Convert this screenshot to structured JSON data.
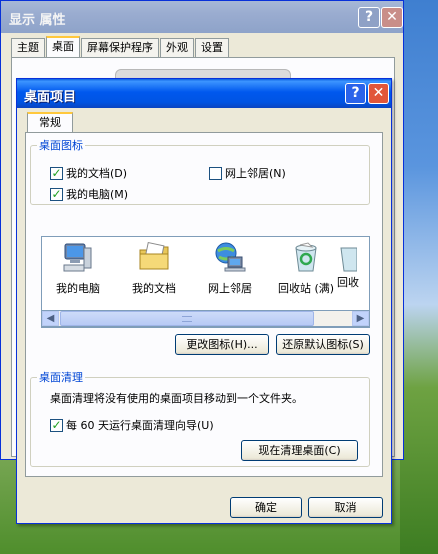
{
  "back_window": {
    "title": "显示 属性",
    "tabs": [
      "主题",
      "桌面",
      "屏幕保护程序",
      "外观",
      "设置"
    ],
    "active_tab_index": 1
  },
  "dialog": {
    "title": "桌面项目",
    "help_symbol": "?",
    "close_symbol": "✕",
    "tab": "常规",
    "desktop_icons": {
      "group_label": "桌面图标",
      "my_documents": {
        "label": "我的文档",
        "hotkey": "(D)",
        "checked": true
      },
      "my_computer": {
        "label": "我的电脑",
        "hotkey": "(M)",
        "checked": true
      },
      "network_places": {
        "label": "网上邻居",
        "hotkey": "(N)",
        "checked": false
      }
    },
    "icon_list": [
      {
        "label": "我的电脑",
        "icon": "my-computer-icon"
      },
      {
        "label": "我的文档",
        "icon": "my-documents-icon"
      },
      {
        "label": "网上邻居",
        "icon": "network-places-icon"
      },
      {
        "label": "回收站 (满)",
        "icon": "recycle-bin-full-icon"
      },
      {
        "label": "回收",
        "icon": "recycle-bin-empty-icon"
      }
    ],
    "change_icon_button": "更改图标(H)...",
    "restore_default_button": "还原默认图标(S)",
    "desktop_cleanup": {
      "group_label": "桌面清理",
      "description": "桌面清理将没有使用的桌面项目移动到一个文件夹。",
      "wizard_checkbox": {
        "label": "每 60 天运行桌面清理向导",
        "hotkey": "(U)",
        "checked": true
      },
      "clean_now_button": "现在清理桌面(C)"
    },
    "ok_button": "确定",
    "cancel_button": "取消"
  },
  "colors": {
    "titlebar_active": "#0054e3",
    "titlebar_inactive": "#9aacd0",
    "group_label": "#0046d5",
    "dialog_bg": "#ece9d8"
  }
}
